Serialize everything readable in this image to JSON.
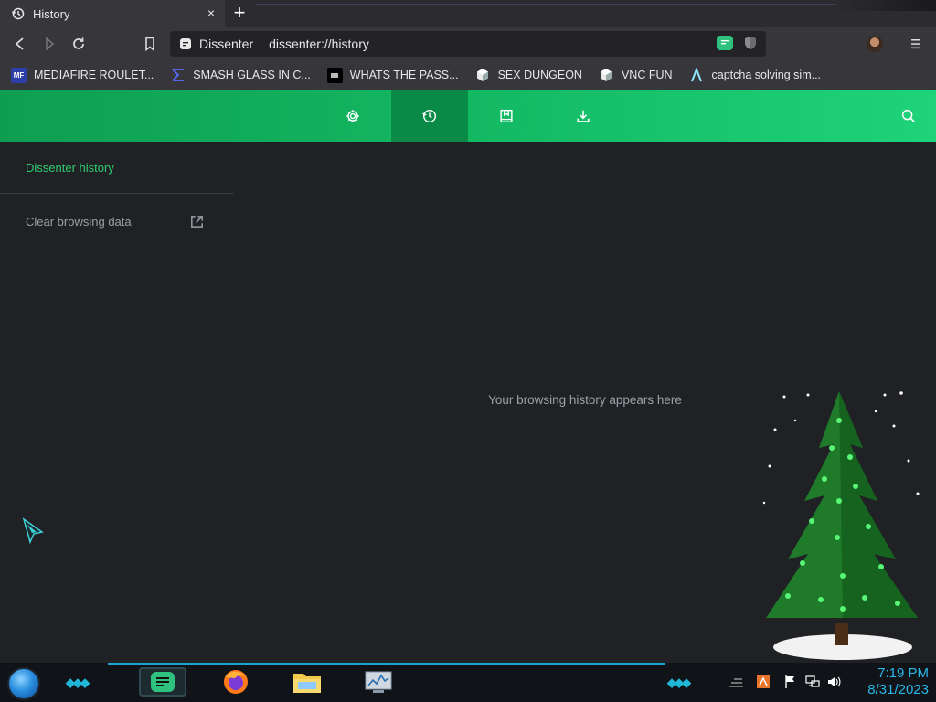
{
  "tab": {
    "title": "History",
    "close": "×",
    "new_tab": "+"
  },
  "address": {
    "site_name": "Dissenter",
    "url": "dissenter://history"
  },
  "bookmarks": [
    {
      "label": "MEDIAFIRE ROULET...",
      "icon": "mediafire-icon"
    },
    {
      "label": "SMASH GLASS IN C...",
      "icon": "sigma-icon"
    },
    {
      "label": "WHATS THE PASS...",
      "icon": "document-icon"
    },
    {
      "label": "SEX DUNGEON",
      "icon": "cube-icon"
    },
    {
      "label": "VNC FUN",
      "icon": "cube-icon"
    },
    {
      "label": "captcha solving sim...",
      "icon": "lambda-icon"
    }
  ],
  "sidebar": {
    "title": "Dissenter history",
    "clear_label": "Clear browsing data"
  },
  "main": {
    "empty_message": "Your browsing history appears here"
  },
  "taskbar": {
    "time": "7:19 PM",
    "date": "8/31/2023"
  },
  "colors": {
    "accent": "#2ecc71",
    "header_start": "#0e9e52",
    "header_end": "#1ed37a",
    "clock": "#2ab8e8"
  }
}
